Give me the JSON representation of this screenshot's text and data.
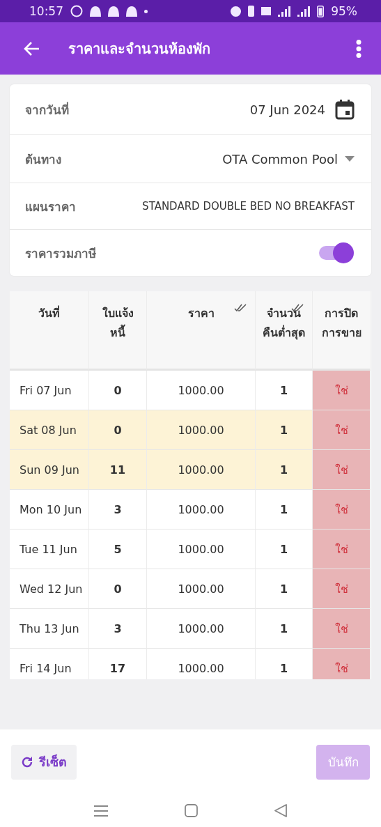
{
  "status_bar": {
    "time": "10:57",
    "battery": "95%"
  },
  "app_bar": {
    "title": "ราคาและจำนวนห้องพัก"
  },
  "form": {
    "from_date": {
      "label": "จากวันที่",
      "value": "07 Jun 2024"
    },
    "source": {
      "label": "ต้นทาง",
      "value": "OTA Common Pool"
    },
    "rate_plan": {
      "label": "แผนราคา",
      "value": "STANDARD DOUBLE BED NO BREAKFAST"
    },
    "tax_included": {
      "label": "ราคารวมภาษี",
      "on": true
    }
  },
  "table": {
    "columns": [
      {
        "label": "วันที่",
        "bulk_edit": false
      },
      {
        "label": "ใบแจ้งหนี้",
        "bulk_edit": false
      },
      {
        "label": "ราคา",
        "bulk_edit": true
      },
      {
        "label": "จำนวนคืนต่ำสุด",
        "bulk_edit": true
      },
      {
        "label": "การปิดการขาย",
        "bulk_edit": false
      }
    ],
    "rows": [
      {
        "date": "Fri 07 Jun",
        "invoices": "0",
        "price": "1000.00",
        "min_nights": "1",
        "stop_sell": "ใช่",
        "weekend": false,
        "closed": true
      },
      {
        "date": "Sat 08 Jun",
        "invoices": "0",
        "price": "1000.00",
        "min_nights": "1",
        "stop_sell": "ใช่",
        "weekend": true,
        "closed": true
      },
      {
        "date": "Sun 09 Jun",
        "invoices": "11",
        "price": "1000.00",
        "min_nights": "1",
        "stop_sell": "ใช่",
        "weekend": true,
        "closed": true
      },
      {
        "date": "Mon 10 Jun",
        "invoices": "3",
        "price": "1000.00",
        "min_nights": "1",
        "stop_sell": "ใช่",
        "weekend": false,
        "closed": true
      },
      {
        "date": "Tue 11 Jun",
        "invoices": "5",
        "price": "1000.00",
        "min_nights": "1",
        "stop_sell": "ใช่",
        "weekend": false,
        "closed": true
      },
      {
        "date": "Wed 12 Jun",
        "invoices": "0",
        "price": "1000.00",
        "min_nights": "1",
        "stop_sell": "ใช่",
        "weekend": false,
        "closed": true
      },
      {
        "date": "Thu 13 Jun",
        "invoices": "3",
        "price": "1000.00",
        "min_nights": "1",
        "stop_sell": "ใช่",
        "weekend": false,
        "closed": true
      },
      {
        "date": "Fri 14 Jun",
        "invoices": "17",
        "price": "1000.00",
        "min_nights": "1",
        "stop_sell": "ใช่",
        "weekend": false,
        "closed": true
      }
    ]
  },
  "footer": {
    "reset": "รีเซ็ต",
    "save": {
      "label": "บันทึก",
      "disabled": true
    }
  }
}
